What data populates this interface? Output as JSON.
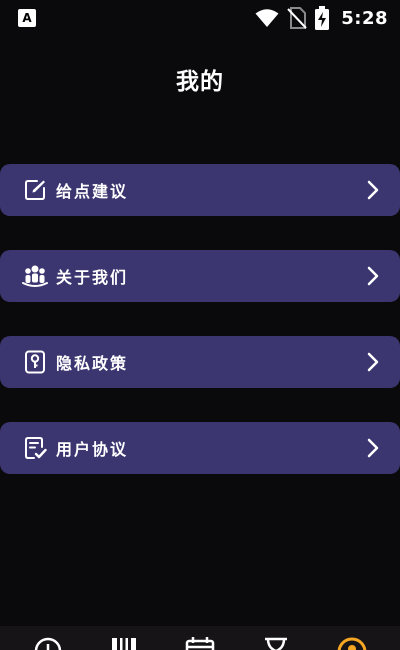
{
  "status_bar": {
    "time": "5:28",
    "app_badge": "A",
    "icons": [
      "wifi-icon",
      "no-sim-icon",
      "battery-charging-icon"
    ]
  },
  "page": {
    "title": "我的"
  },
  "menu": {
    "items": [
      {
        "label": "给点建议",
        "icon": "edit-icon"
      },
      {
        "label": "关于我们",
        "icon": "group-icon"
      },
      {
        "label": "隐私政策",
        "icon": "privacy-lock-icon"
      },
      {
        "label": "用户协议",
        "icon": "agreement-check-icon"
      }
    ]
  },
  "bottom_nav": {
    "items": [
      {
        "icon": "clock-icon"
      },
      {
        "icon": "piano-icon"
      },
      {
        "icon": "calendar-icon"
      },
      {
        "icon": "hourglass-icon"
      },
      {
        "icon": "profile-icon",
        "active": true
      }
    ]
  },
  "colors": {
    "background": "#0a090b",
    "card": "#3b3670",
    "text": "#ffffff",
    "active_nav": "#f5a623"
  }
}
